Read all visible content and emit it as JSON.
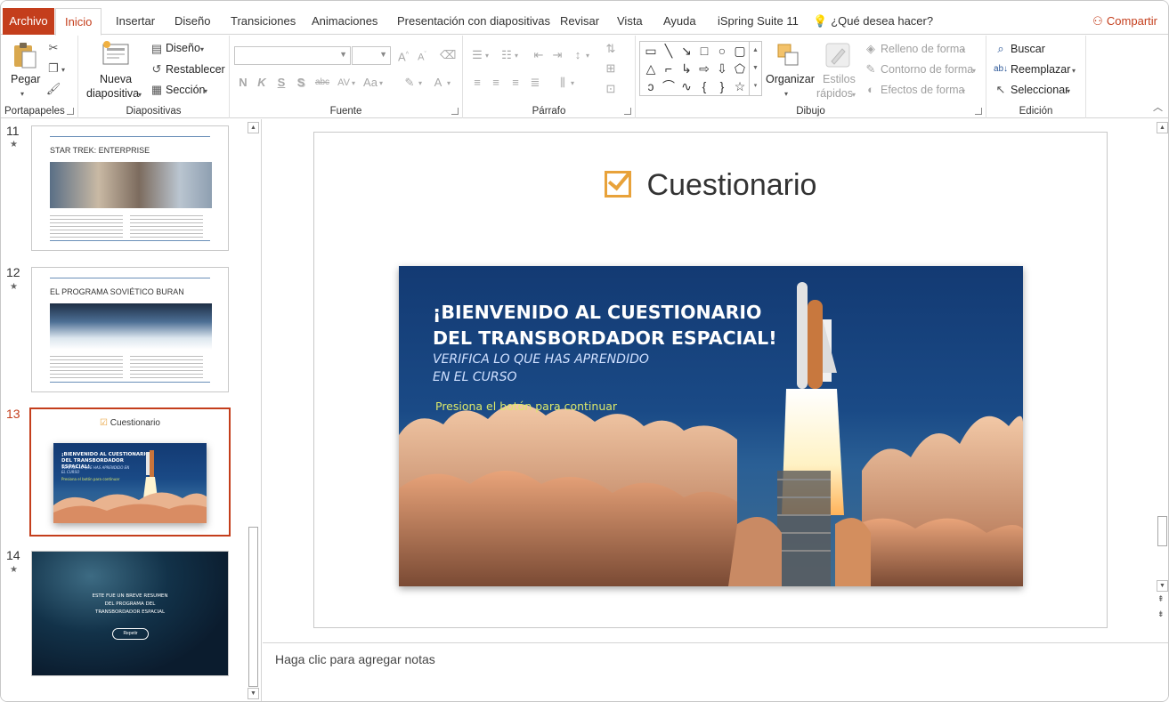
{
  "ribbon_tabs": {
    "file": "Archivo",
    "home": "Inicio",
    "insert": "Insertar",
    "design": "Diseño",
    "transitions": "Transiciones",
    "animations": "Animaciones",
    "slideshow": "Presentación con diapositivas",
    "review": "Revisar",
    "view": "Vista",
    "help": "Ayuda",
    "ispring": "iSpring Suite 11",
    "tell_me": "¿Qué desea hacer?",
    "share": "Compartir"
  },
  "clipboard": {
    "paste": "Pegar",
    "label": "Portapapeles"
  },
  "slides_group": {
    "new_slide_line1": "Nueva",
    "new_slide_line2": "diapositiva",
    "layout": "Diseño",
    "reset": "Restablecer",
    "section": "Sección",
    "label": "Diapositivas"
  },
  "font_group": {
    "label": "Fuente",
    "bold": "N",
    "italic": "K",
    "underline": "S",
    "shadow": "S",
    "strike": "abc",
    "spacing": "AV",
    "case": "Aa",
    "color": "A"
  },
  "paragraph_group": {
    "label": "Párrafo"
  },
  "drawing_group": {
    "label": "Dibujo",
    "arrange": "Organizar",
    "quick_styles_line1": "Estilos",
    "quick_styles_line2": "rápidos",
    "shape_fill": "Relleno de forma",
    "shape_outline": "Contorno de forma",
    "shape_effects": "Efectos de forma"
  },
  "editing_group": {
    "label": "Edición",
    "find": "Buscar",
    "replace": "Reemplazar",
    "select": "Seleccionar"
  },
  "thumbnails": [
    {
      "number": "11",
      "title": "STAR TREK: ENTERPRISE"
    },
    {
      "number": "12",
      "title": "EL PROGRAMA SOVIÉTICO BURAN"
    },
    {
      "number": "13",
      "title": "Cuestionario",
      "heading": "¡BIENVENIDO AL CUESTIONARIO DEL TRANSBORDADOR ESPACIAL!",
      "sub": "VERIFICA LO QUE HAS APRENDIDO EN EL CURSO",
      "cta": "Presiona el botón para continuar"
    },
    {
      "number": "14",
      "line1": "ESTE FUE UN BREVE RESUMEN",
      "line2": "DEL PROGRAMA DEL",
      "line3": "TRANSBORDADOR ESPACIAL",
      "button": "Repetir"
    }
  ],
  "slide": {
    "title": "Cuestionario",
    "banner": {
      "heading_line1": "¡BIENVENIDO AL CUESTIONARIO",
      "heading_line2": "DEL  TRANSBORDADOR ESPACIAL!",
      "sub_line1": "VERIFICA LO QUE HAS APRENDIDO",
      "sub_line2": "EN EL CURSO",
      "cta": "Presiona el botón para continuar"
    }
  },
  "notes": {
    "placeholder": "Haga clic para agregar notas"
  },
  "colors": {
    "accent": "#c43e1c",
    "check": "#e8a23a",
    "banner_blue": "#133a73",
    "cta_yellow": "#dce86a"
  }
}
